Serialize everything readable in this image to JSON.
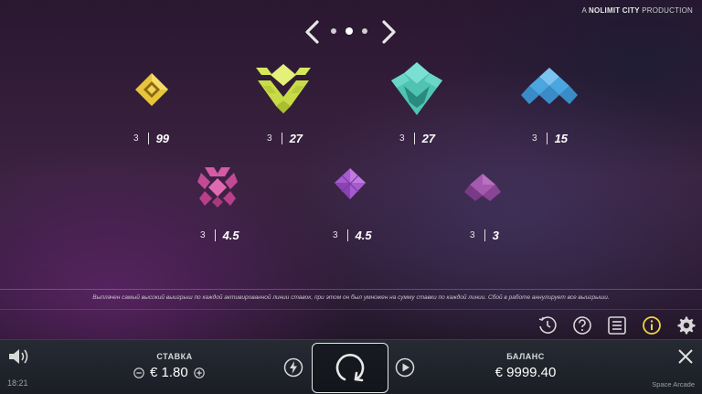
{
  "brand": {
    "prefix": "A",
    "name": "NOLIMIT CITY",
    "suffix": "PRODUCTION"
  },
  "pager": {
    "pages": 3,
    "active": 1
  },
  "paytable": [
    {
      "symbol": "yellow-diamond-symbol",
      "color": "#e8c43a",
      "count": "3",
      "payout": "99"
    },
    {
      "symbol": "lime-w-symbol",
      "color": "#d6e85a",
      "count": "3",
      "payout": "27"
    },
    {
      "symbol": "teal-v-symbol",
      "color": "#5ad0c0",
      "count": "3",
      "payout": "27"
    },
    {
      "symbol": "blue-pyramid-symbol",
      "color": "#4aa6e0",
      "count": "3",
      "payout": "15"
    },
    {
      "symbol": "pink-cross-symbol",
      "color": "#d65aa6",
      "count": "3",
      "payout": "4.5"
    },
    {
      "symbol": "purple-diamond-symbol",
      "color": "#a85ad0",
      "count": "3",
      "payout": "4.5"
    },
    {
      "symbol": "violet-small-symbol",
      "color": "#9a4aa6",
      "count": "3",
      "payout": "3"
    }
  ],
  "rules_text": "Выплачен самый высокий выигрыш по каждой активированной линии ставок, при этом он был умножен на сумму ставки по каждой линии. Сбой в работе аннулирует все выигрыши.",
  "toolbar": [
    "history-icon",
    "help-icon",
    "paytable-icon",
    "info-icon",
    "settings-icon"
  ],
  "bottom": {
    "clock": "18:21",
    "bet_label": "СТАВКА",
    "bet_value": "€ 1.80",
    "balance_label": "БАЛАНС",
    "balance_value": "€ 9999.40",
    "game_name": "Space Arcade"
  }
}
